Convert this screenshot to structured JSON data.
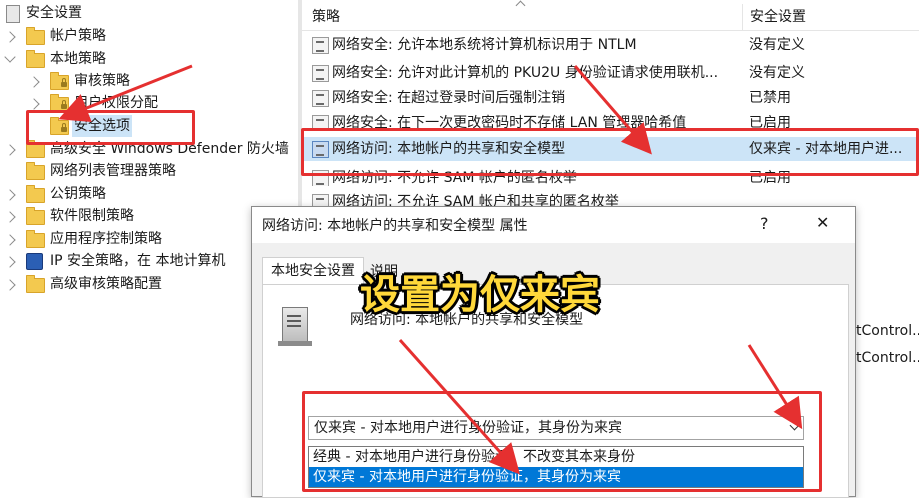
{
  "tree": {
    "root": "安全设置",
    "items": [
      {
        "label": "帐户策略"
      },
      {
        "label": "本地策略"
      },
      {
        "label": "审核策略"
      },
      {
        "label": "用户权限分配"
      },
      {
        "label": "安全选项"
      },
      {
        "label": "高级安全 Windows Defender 防火墙"
      },
      {
        "label": "网络列表管理器策略"
      },
      {
        "label": "公钥策略"
      },
      {
        "label": "软件限制策略"
      },
      {
        "label": "应用程序控制策略"
      },
      {
        "label": "IP 安全策略，在 本地计算机"
      },
      {
        "label": "高级审核策略配置"
      }
    ]
  },
  "list": {
    "col_policy": "策略",
    "col_setting": "安全设置",
    "rows": [
      {
        "policy": "网络安全: 允许本地系统将计算机标识用于 NTLM",
        "setting": "没有定义"
      },
      {
        "policy": "网络安全: 允许对此计算机的 PKU2U 身份验证请求使用联机...",
        "setting": "没有定义"
      },
      {
        "policy": "网络安全: 在超过登录时间后强制注销",
        "setting": "已禁用"
      },
      {
        "policy": "网络安全: 在下一次更改密码时不存储 LAN 管理器哈希值",
        "setting": "已启用"
      },
      {
        "policy": "网络访问: 本地帐户的共享和安全模型",
        "setting": "仅来宾 - 对本地用户进..."
      },
      {
        "policy": "网络访问: 不允许 SAM 帐户的匿名枚举",
        "setting": "已启用"
      },
      {
        "policy": "网络访问: 不允许 SAM 帐户和共享的匿名枚举",
        "setting": ""
      }
    ],
    "partial_right": [
      "tControl...",
      "tControl..."
    ]
  },
  "dialog": {
    "title": "网络访问: 本地帐户的共享和安全模型 属性",
    "help_glyph": "?",
    "close_glyph": "✕",
    "tab_local": "本地安全设置",
    "tab_explain": "说明",
    "policy_name": "网络访问: 本地帐户的共享和安全模型",
    "combo_value": "仅来宾 - 对本地用户进行身份验证，其身份为来宾",
    "options": [
      "经典 - 对本地用户进行身份验证，不改变其本来身份",
      "仅来宾 - 对本地用户进行身份验证，其身份为来宾"
    ]
  },
  "annotation": {
    "text": "设置为仅来宾",
    "color": "#e53030",
    "text_color": "#ffd83a"
  }
}
